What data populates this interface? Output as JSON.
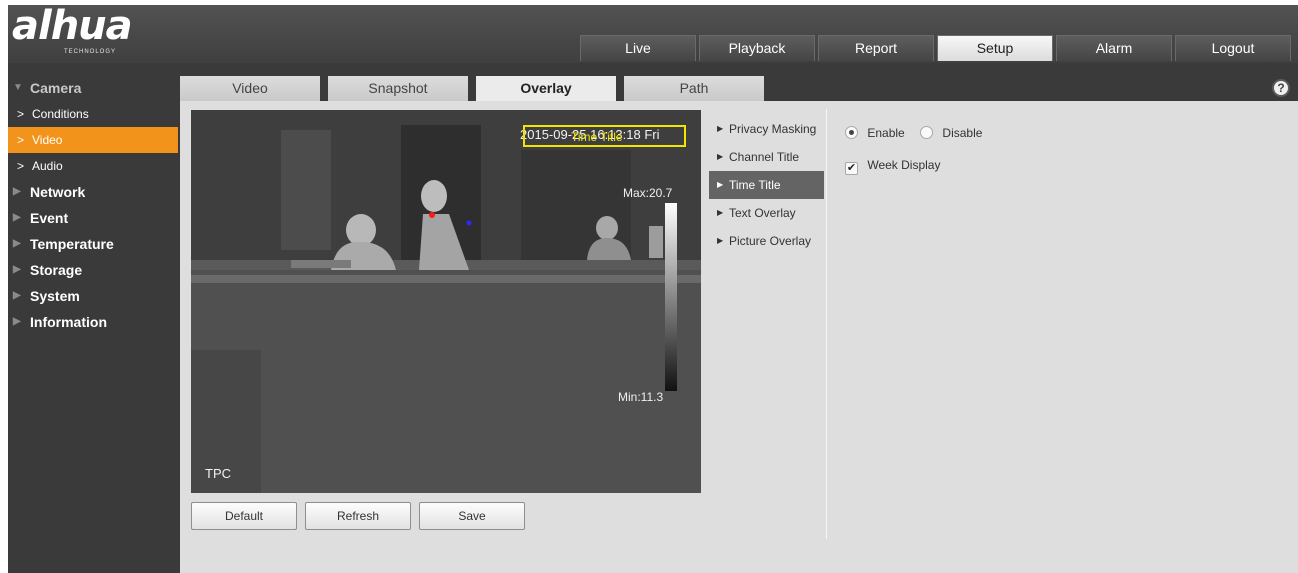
{
  "brand": {
    "name": "alhua",
    "sub": "TECHNOLOGY"
  },
  "topnav": [
    {
      "label": "Live",
      "active": false
    },
    {
      "label": "Playback",
      "active": false
    },
    {
      "label": "Report",
      "active": false
    },
    {
      "label": "Setup",
      "active": true
    },
    {
      "label": "Alarm",
      "active": false
    },
    {
      "label": "Logout",
      "active": false
    }
  ],
  "sidebar": {
    "camera": "Camera",
    "camera_sub": [
      "Conditions",
      "Video",
      "Audio"
    ],
    "active_sub": "Video",
    "items": [
      "Network",
      "Event",
      "Temperature",
      "Storage",
      "System",
      "Information"
    ]
  },
  "subtabs": [
    {
      "label": "Video",
      "active": false
    },
    {
      "label": "Snapshot",
      "active": false
    },
    {
      "label": "Overlay",
      "active": true
    },
    {
      "label": "Path",
      "active": false
    }
  ],
  "preview": {
    "timestamp": "2015-09-25 16:13:18 Fri",
    "title_box_label": "Time Title",
    "max_label": "Max:20.7",
    "min_label": "Min:11.3",
    "channel_label": "TPC"
  },
  "buttons": {
    "default": "Default",
    "refresh": "Refresh",
    "save": "Save"
  },
  "overlay_menu": [
    "Privacy Masking",
    "Channel Title",
    "Time Title",
    "Text Overlay",
    "Picture Overlay"
  ],
  "overlay_active": "Time Title",
  "settings": {
    "enable": "Enable",
    "disable": "Disable",
    "enabled": true,
    "week_display": "Week Display",
    "week_display_checked": true
  },
  "icons": {
    "help": "help-icon"
  },
  "colors": {
    "accent": "#f2941b",
    "title_box": "#f3e400"
  }
}
